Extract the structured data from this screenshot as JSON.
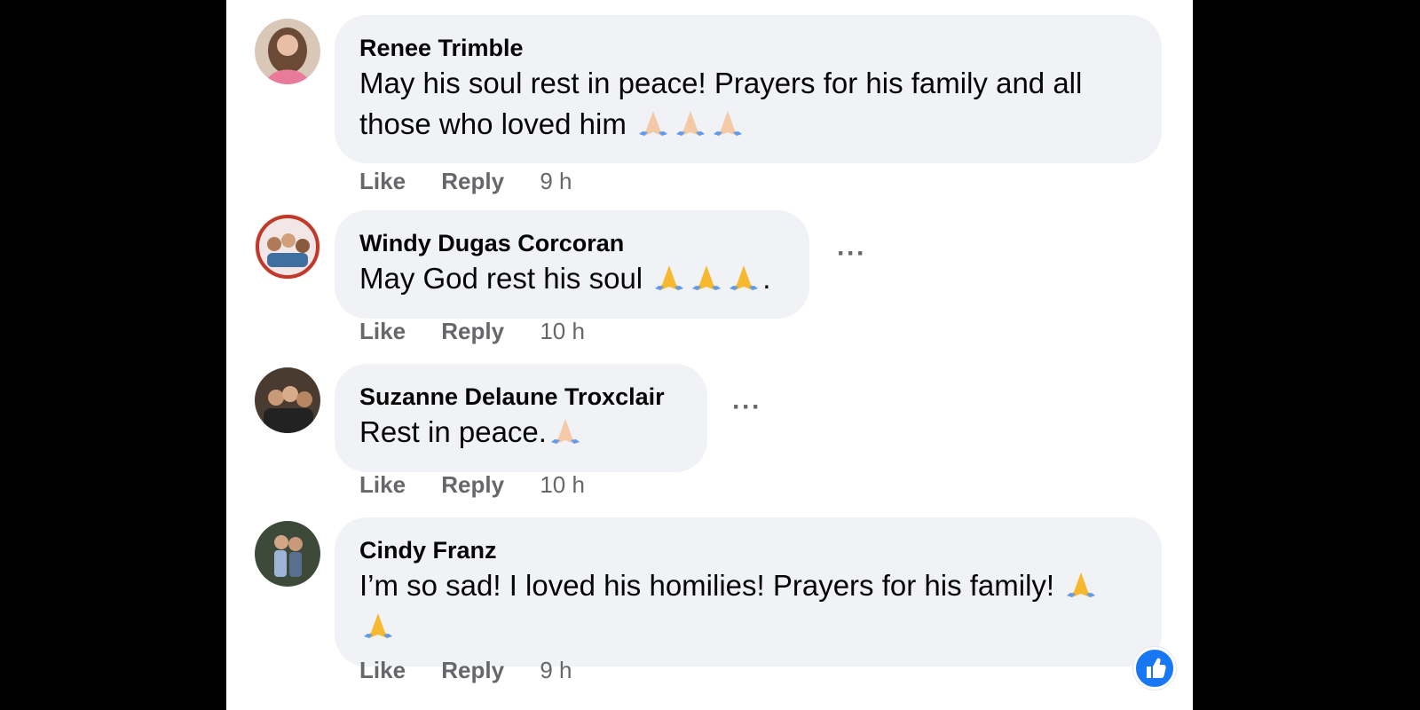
{
  "comments": [
    {
      "author": "Renee Trimble",
      "text_line1": "May his soul rest in peace! Prayers for his family and all",
      "text_line2": "those who loved him",
      "emoji": "🙏🙏🙏",
      "like_label": "Like",
      "reply_label": "Reply",
      "time": "9 h"
    },
    {
      "author": "Windy Dugas Corcoran",
      "text_line1": "May God rest his soul",
      "emoji": "🙏🙏🙏",
      "text_after": ".",
      "like_label": "Like",
      "reply_label": "Reply",
      "time": "10 h",
      "more": "···"
    },
    {
      "author": "Suzanne Delaune Troxclair",
      "text_line1": "Rest in peace.",
      "emoji": "🙏",
      "like_label": "Like",
      "reply_label": "Reply",
      "time": "10 h",
      "more": "···"
    },
    {
      "author": "Cindy Franz",
      "text_line1": "I’m so sad! I loved his homilies! Prayers for his family!",
      "emoji": "🙏",
      "emoji_line2": "🙏",
      "like_label": "Like",
      "reply_label": "Reply",
      "time": "9 h"
    }
  ],
  "colors": {
    "bubble": "#f0f2f5",
    "secondary_text": "#65676b",
    "like_blue": "#1877f2"
  },
  "icons": {
    "reaction": "thumbs-up-icon",
    "more": "more-options-icon"
  }
}
